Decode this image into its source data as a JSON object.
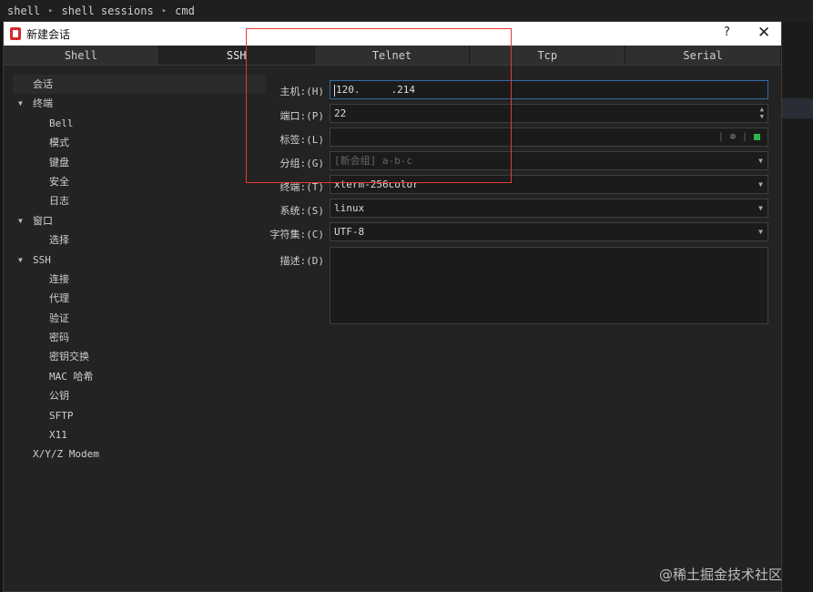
{
  "breadcrumb": [
    "shell",
    "shell sessions",
    "cmd"
  ],
  "dialog": {
    "title": "新建会话",
    "help": "?",
    "close": "✕"
  },
  "tabs": [
    {
      "label": "Shell",
      "active": false
    },
    {
      "label": "SSH",
      "active": true
    },
    {
      "label": "Telnet",
      "active": false
    },
    {
      "label": "Tcp",
      "active": false
    },
    {
      "label": "Serial",
      "active": false
    }
  ],
  "tree": [
    {
      "label": "会话",
      "level": 1,
      "selected": true
    },
    {
      "label": "终端",
      "level": 0,
      "expanded": true
    },
    {
      "label": "Bell",
      "level": 2
    },
    {
      "label": "模式",
      "level": 2
    },
    {
      "label": "键盘",
      "level": 2
    },
    {
      "label": "安全",
      "level": 2
    },
    {
      "label": "日志",
      "level": 2
    },
    {
      "label": "窗口",
      "level": 0,
      "expanded": true
    },
    {
      "label": "选择",
      "level": 2
    },
    {
      "label": "SSH",
      "level": 0,
      "expanded": true
    },
    {
      "label": "连接",
      "level": 2
    },
    {
      "label": "代理",
      "level": 2
    },
    {
      "label": "验证",
      "level": 2
    },
    {
      "label": "密码",
      "level": 2
    },
    {
      "label": "密钥交换",
      "level": 2
    },
    {
      "label": "MAC 哈希",
      "level": 2
    },
    {
      "label": "公钥",
      "level": 2
    },
    {
      "label": "SFTP",
      "level": 2
    },
    {
      "label": "X11",
      "level": 2
    },
    {
      "label": "X/Y/Z Modem",
      "level": 1
    }
  ],
  "form": {
    "host_label": "主机:(H)",
    "host_value_a": "120.",
    "host_value_b": ".214",
    "port_label": "端口:(P)",
    "port_value": "22",
    "tag_label": "标签:(L)",
    "tag_value": "",
    "group_label": "分组:(G)",
    "group_value": "[新会组] a-b-c",
    "terminal_label": "终端:(T)",
    "terminal_value": "xterm-256color",
    "system_label": "系统:(S)",
    "system_value": "linux",
    "charset_label": "字符集:(C)",
    "charset_value": "UTF-8",
    "desc_label": "描述:(D)",
    "desc_value": ""
  },
  "icons": {
    "dropdown": "▼",
    "spinner_up": "▲",
    "spinner_down": "▼",
    "clear": "⊘",
    "tree_expanded": "▼",
    "breadcrumb_sep": "▸"
  },
  "watermark": "@稀土掘金技术社区",
  "colors": {
    "accent_focus": "#2f6aa8",
    "annotation_red": "#e53935",
    "status_green": "#2fb34a",
    "app_icon_red": "#d42a2a"
  }
}
